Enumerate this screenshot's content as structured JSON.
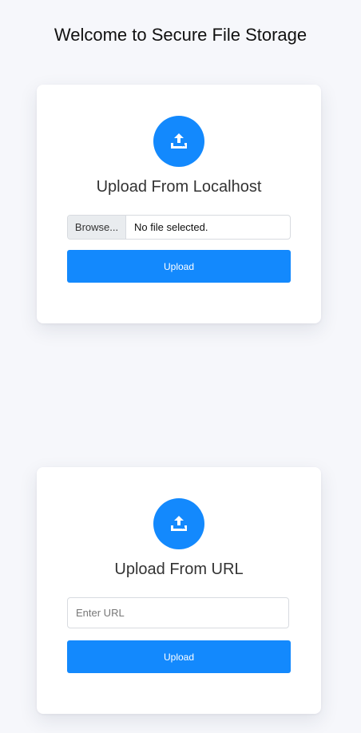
{
  "page": {
    "title": "Welcome to Secure File Storage"
  },
  "theme": {
    "accent": "#1389fd",
    "background": "#f6f7fb"
  },
  "local_card": {
    "icon": "upload-tray-icon",
    "heading": "Upload From Localhost",
    "browse_label": "Browse...",
    "file_status": "No file selected.",
    "upload_label": "Upload"
  },
  "url_card": {
    "icon": "upload-tray-icon",
    "heading": "Upload From URL",
    "url_value": "",
    "url_placeholder": "Enter URL",
    "upload_label": "Upload"
  }
}
